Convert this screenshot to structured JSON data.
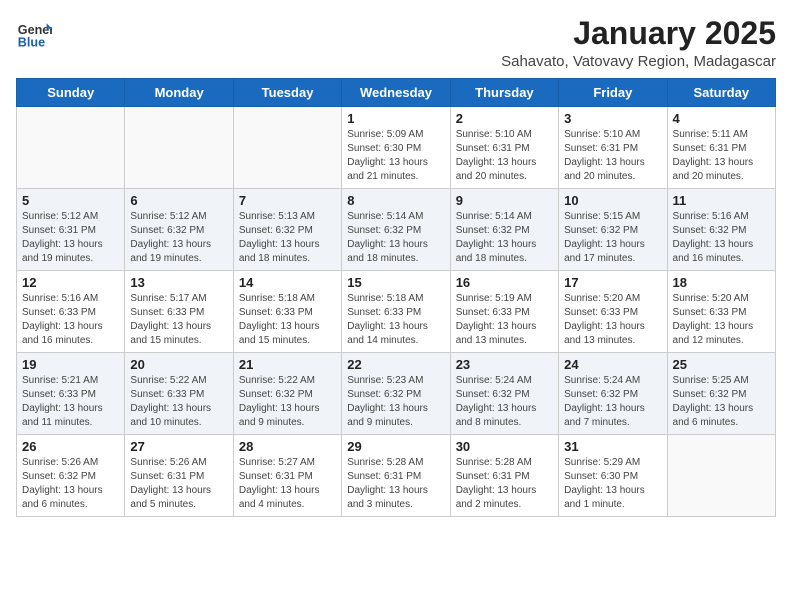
{
  "header": {
    "logo_general": "General",
    "logo_blue": "Blue",
    "month_year": "January 2025",
    "location": "Sahavato, Vatovavy Region, Madagascar"
  },
  "weekdays": [
    "Sunday",
    "Monday",
    "Tuesday",
    "Wednesday",
    "Thursday",
    "Friday",
    "Saturday"
  ],
  "weeks": [
    [
      {
        "day": "",
        "info": ""
      },
      {
        "day": "",
        "info": ""
      },
      {
        "day": "",
        "info": ""
      },
      {
        "day": "1",
        "info": "Sunrise: 5:09 AM\nSunset: 6:30 PM\nDaylight: 13 hours\nand 21 minutes."
      },
      {
        "day": "2",
        "info": "Sunrise: 5:10 AM\nSunset: 6:31 PM\nDaylight: 13 hours\nand 20 minutes."
      },
      {
        "day": "3",
        "info": "Sunrise: 5:10 AM\nSunset: 6:31 PM\nDaylight: 13 hours\nand 20 minutes."
      },
      {
        "day": "4",
        "info": "Sunrise: 5:11 AM\nSunset: 6:31 PM\nDaylight: 13 hours\nand 20 minutes."
      }
    ],
    [
      {
        "day": "5",
        "info": "Sunrise: 5:12 AM\nSunset: 6:31 PM\nDaylight: 13 hours\nand 19 minutes."
      },
      {
        "day": "6",
        "info": "Sunrise: 5:12 AM\nSunset: 6:32 PM\nDaylight: 13 hours\nand 19 minutes."
      },
      {
        "day": "7",
        "info": "Sunrise: 5:13 AM\nSunset: 6:32 PM\nDaylight: 13 hours\nand 18 minutes."
      },
      {
        "day": "8",
        "info": "Sunrise: 5:14 AM\nSunset: 6:32 PM\nDaylight: 13 hours\nand 18 minutes."
      },
      {
        "day": "9",
        "info": "Sunrise: 5:14 AM\nSunset: 6:32 PM\nDaylight: 13 hours\nand 18 minutes."
      },
      {
        "day": "10",
        "info": "Sunrise: 5:15 AM\nSunset: 6:32 PM\nDaylight: 13 hours\nand 17 minutes."
      },
      {
        "day": "11",
        "info": "Sunrise: 5:16 AM\nSunset: 6:32 PM\nDaylight: 13 hours\nand 16 minutes."
      }
    ],
    [
      {
        "day": "12",
        "info": "Sunrise: 5:16 AM\nSunset: 6:33 PM\nDaylight: 13 hours\nand 16 minutes."
      },
      {
        "day": "13",
        "info": "Sunrise: 5:17 AM\nSunset: 6:33 PM\nDaylight: 13 hours\nand 15 minutes."
      },
      {
        "day": "14",
        "info": "Sunrise: 5:18 AM\nSunset: 6:33 PM\nDaylight: 13 hours\nand 15 minutes."
      },
      {
        "day": "15",
        "info": "Sunrise: 5:18 AM\nSunset: 6:33 PM\nDaylight: 13 hours\nand 14 minutes."
      },
      {
        "day": "16",
        "info": "Sunrise: 5:19 AM\nSunset: 6:33 PM\nDaylight: 13 hours\nand 13 minutes."
      },
      {
        "day": "17",
        "info": "Sunrise: 5:20 AM\nSunset: 6:33 PM\nDaylight: 13 hours\nand 13 minutes."
      },
      {
        "day": "18",
        "info": "Sunrise: 5:20 AM\nSunset: 6:33 PM\nDaylight: 13 hours\nand 12 minutes."
      }
    ],
    [
      {
        "day": "19",
        "info": "Sunrise: 5:21 AM\nSunset: 6:33 PM\nDaylight: 13 hours\nand 11 minutes."
      },
      {
        "day": "20",
        "info": "Sunrise: 5:22 AM\nSunset: 6:33 PM\nDaylight: 13 hours\nand 10 minutes."
      },
      {
        "day": "21",
        "info": "Sunrise: 5:22 AM\nSunset: 6:32 PM\nDaylight: 13 hours\nand 9 minutes."
      },
      {
        "day": "22",
        "info": "Sunrise: 5:23 AM\nSunset: 6:32 PM\nDaylight: 13 hours\nand 9 minutes."
      },
      {
        "day": "23",
        "info": "Sunrise: 5:24 AM\nSunset: 6:32 PM\nDaylight: 13 hours\nand 8 minutes."
      },
      {
        "day": "24",
        "info": "Sunrise: 5:24 AM\nSunset: 6:32 PM\nDaylight: 13 hours\nand 7 minutes."
      },
      {
        "day": "25",
        "info": "Sunrise: 5:25 AM\nSunset: 6:32 PM\nDaylight: 13 hours\nand 6 minutes."
      }
    ],
    [
      {
        "day": "26",
        "info": "Sunrise: 5:26 AM\nSunset: 6:32 PM\nDaylight: 13 hours\nand 6 minutes."
      },
      {
        "day": "27",
        "info": "Sunrise: 5:26 AM\nSunset: 6:31 PM\nDaylight: 13 hours\nand 5 minutes."
      },
      {
        "day": "28",
        "info": "Sunrise: 5:27 AM\nSunset: 6:31 PM\nDaylight: 13 hours\nand 4 minutes."
      },
      {
        "day": "29",
        "info": "Sunrise: 5:28 AM\nSunset: 6:31 PM\nDaylight: 13 hours\nand 3 minutes."
      },
      {
        "day": "30",
        "info": "Sunrise: 5:28 AM\nSunset: 6:31 PM\nDaylight: 13 hours\nand 2 minutes."
      },
      {
        "day": "31",
        "info": "Sunrise: 5:29 AM\nSunset: 6:30 PM\nDaylight: 13 hours\nand 1 minute."
      },
      {
        "day": "",
        "info": ""
      }
    ]
  ]
}
